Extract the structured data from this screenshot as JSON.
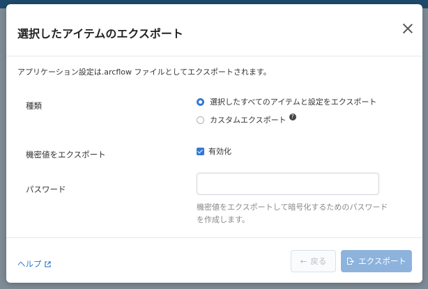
{
  "dialog": {
    "title": "選択したアイテムのエクスポート",
    "description": "アプリケーション設定は.arcflow ファイルとしてエクスポートされます。"
  },
  "form": {
    "type_label": "種類",
    "type_options": [
      {
        "label": "選択したすべてのアイテムと設定をエクスポート",
        "selected": true
      },
      {
        "label": "カスタムエクスポート",
        "selected": false
      }
    ],
    "secret_label": "機密値をエクスポート",
    "secret_checkbox_label": "有効化",
    "secret_checked": true,
    "password_label": "パスワード",
    "password_value": "",
    "password_hint": "機密値をエクスポートして暗号化するためのパスワードを作成します。"
  },
  "footer": {
    "help_label": "ヘルプ",
    "back_label": "戻る",
    "export_label": "エクスポート"
  },
  "colors": {
    "accent": "#3478d4",
    "export_button_disabled": "#8db3dd",
    "link": "#2f77c9"
  },
  "icons": [
    "close-icon",
    "question-icon",
    "external-link-icon",
    "arrow-left-icon",
    "export-file-icon"
  ]
}
